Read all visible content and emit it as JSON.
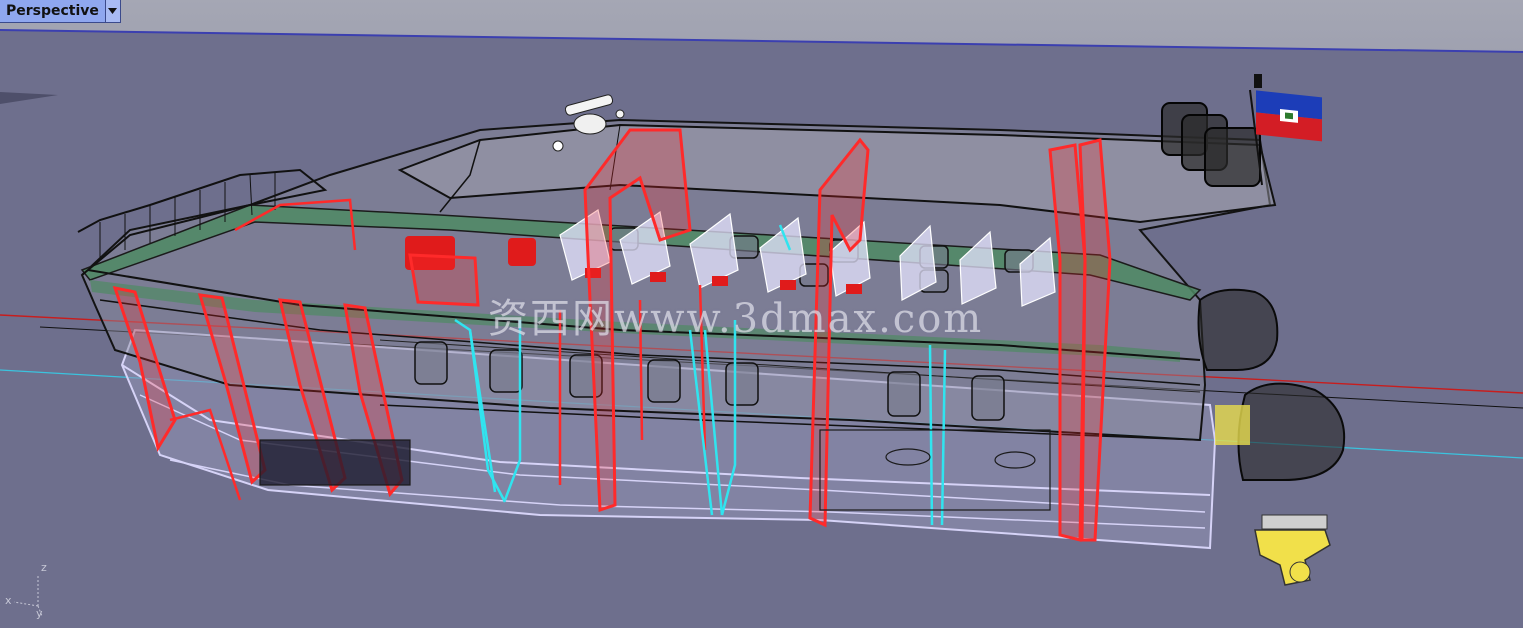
{
  "viewport": {
    "name": "Perspective",
    "watermark_text": "资西网www.3dmax.com",
    "axes": {
      "z": "z",
      "x": "x",
      "y": "y"
    }
  },
  "icons": {
    "dropdown": "chevron-down-icon",
    "flag": "haiti-flag-icon"
  },
  "colors": {
    "viewport_background": "#6e6f8d",
    "tab_background": "#8fa7ef",
    "frame_red": "#ff2a2a",
    "frame_cyan": "#30e4ef",
    "hull_wire": "#151515",
    "hull_lilac": "#c9c4f2",
    "deck_green": "#4f8a64",
    "outboard_yellow": "#f1e04a"
  }
}
